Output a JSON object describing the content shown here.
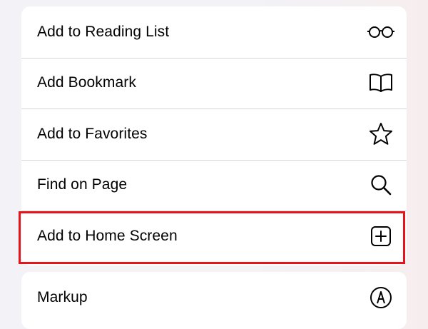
{
  "menu": {
    "group1": [
      {
        "label": "Add to Reading List",
        "icon": "reading-glasses-icon"
      },
      {
        "label": "Add Bookmark",
        "icon": "open-book-icon"
      },
      {
        "label": "Add to Favorites",
        "icon": "star-icon"
      },
      {
        "label": "Find on Page",
        "icon": "magnifying-glass-icon"
      },
      {
        "label": "Add to Home Screen",
        "icon": "plus-square-icon"
      }
    ],
    "group2": [
      {
        "label": "Markup",
        "icon": "markup-pen-icon"
      }
    ]
  },
  "colors": {
    "highlight": "#e5141b",
    "background": "#f2f2f7",
    "row_background": "#ffffff",
    "separator": "#d7d7dc"
  }
}
